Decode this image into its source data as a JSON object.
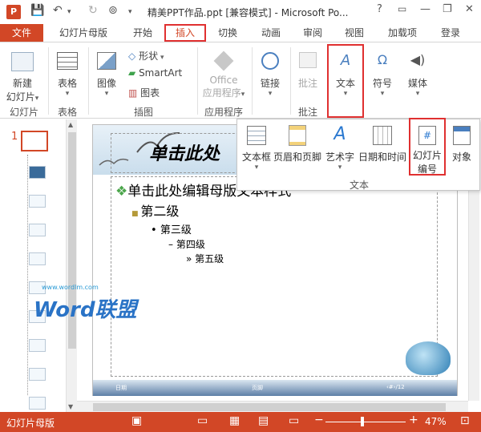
{
  "titlebar": {
    "app_icon": "P",
    "title": "精美PPT作品.ppt [兼容模式] - Microsoft Po...",
    "help": "?",
    "ribbon_display_icon": "ribbon-display-icon",
    "minimize": "—",
    "restore": "❐",
    "close": "✕"
  },
  "tabs": {
    "file": "文件",
    "items": [
      "幻灯片母版",
      "开始",
      "插入",
      "切换",
      "动画",
      "审阅",
      "视图",
      "加载项",
      "登录"
    ]
  },
  "ribbon": {
    "new_slide_line1": "新建",
    "new_slide_line2": "幻灯片",
    "table": "表格",
    "image": "图像",
    "shape": "形状",
    "smartart": "SmartArt",
    "chart": "图表",
    "office_apps_line1": "Office",
    "office_apps_line2": "应用程序",
    "link": "链接",
    "comment": "批注",
    "text": "文本",
    "symbol": "符号",
    "media": "媒体",
    "groups": {
      "slides": "幻灯片",
      "tables": "表格",
      "illustrations": "插图",
      "apps": "应用程序",
      "comments": "批注"
    }
  },
  "text_panel": {
    "textbox": "文本框",
    "header_footer": "页眉和页脚",
    "wordart": "艺术字",
    "datetime": "日期和时间",
    "slide_number_line1": "幻灯片",
    "slide_number_line2": "编号",
    "object": "对象",
    "group_label": "文本"
  },
  "thumbnails": {
    "selected_index": "1"
  },
  "slide": {
    "title": "单击此处",
    "level1": "单击此处编辑母版文本样式",
    "level2": "第二级",
    "level3": "第三级",
    "level4": "第四级",
    "level5": "第五级",
    "footer_date": "日期",
    "footer_center": "页脚",
    "footer_number": "‹#›/12",
    "watermark_url": "www.wordlm.com",
    "watermark_logo": "Word联盟"
  },
  "statusbar": {
    "view_name": "幻灯片母版",
    "zoom_minus": "−",
    "zoom_plus": "+",
    "zoom": "47%"
  },
  "colors": {
    "accent": "#d24726",
    "highlight_box": "#e03030"
  }
}
